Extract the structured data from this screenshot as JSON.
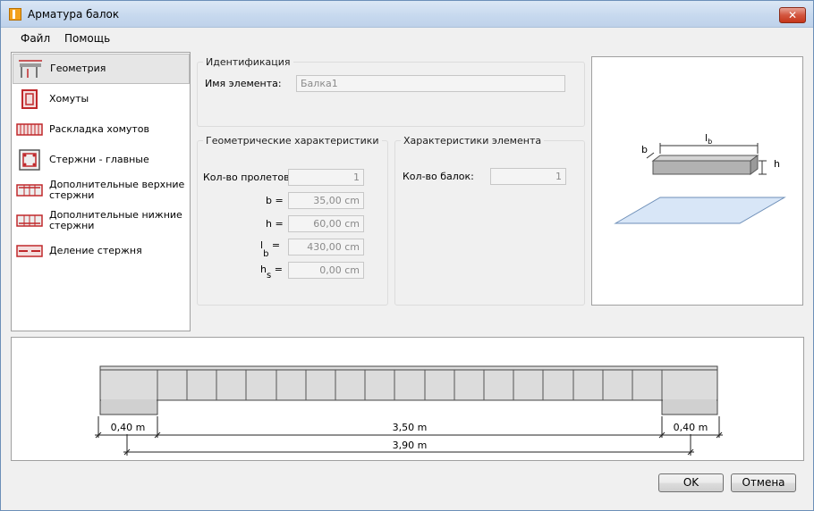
{
  "window": {
    "title": "Арматура балок",
    "close_label": "✕"
  },
  "menu": {
    "items": [
      "Файл",
      "Помощь"
    ]
  },
  "nav": {
    "items": [
      {
        "label": "Геометрия",
        "icon": "beam-geometry-icon"
      },
      {
        "label": "Хомуты",
        "icon": "stirrup-icon"
      },
      {
        "label": "Раскладка хомутов",
        "icon": "stirrup-layout-icon"
      },
      {
        "label": "Стержни - главные",
        "icon": "main-bars-icon"
      },
      {
        "label": "Дополнительные верхние стержни",
        "icon": "top-bars-icon"
      },
      {
        "label": "Дополнительные нижние стержни",
        "icon": "bottom-bars-icon"
      },
      {
        "label": "Деление стержня",
        "icon": "bar-division-icon"
      }
    ],
    "selected": "Геометрия"
  },
  "identification": {
    "title": "Идентификация",
    "name_label": "Имя элемента:",
    "name_value": "Балка1"
  },
  "geometry": {
    "title": "Геометрические характеристики",
    "spans_label": "Кол-во пролетов:",
    "spans_value": "1",
    "b_label": "b =",
    "b_value": "35,00 cm",
    "h_label": "h =",
    "h_value": "60,00 cm",
    "lb_label": "l",
    "lb_sub": "b",
    "lb_eq": "=",
    "lb_value": "430,00 cm",
    "hs_label": "h",
    "hs_sub": "s",
    "hs_eq": "=",
    "hs_value": "0,00 cm"
  },
  "element": {
    "title": "Характеристики элемента",
    "beams_label": "Кол-во балок:",
    "beams_value": "1"
  },
  "preview": {
    "b": "b",
    "h": "h",
    "lb": "l",
    "lb_sub": "b"
  },
  "beam_diagram": {
    "left_support": "0,40 m",
    "span": "3,50 m",
    "right_support": "0,40 m",
    "total": "3,90 m"
  },
  "buttons": {
    "ok": "OK",
    "cancel": "Отмена"
  },
  "colors": {
    "stirrup_red": "#c0282b",
    "plane_blue": "#d8e6f7"
  }
}
